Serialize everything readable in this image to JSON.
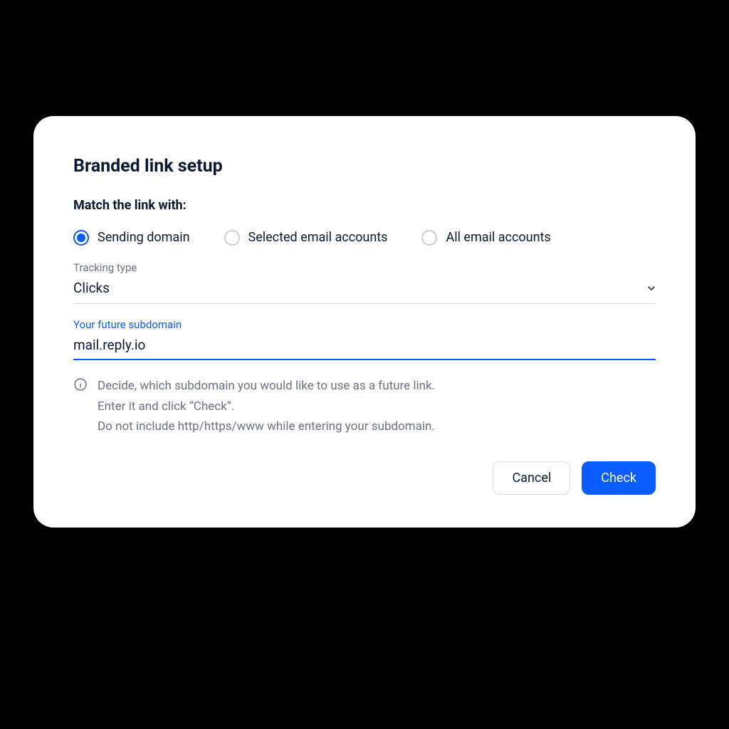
{
  "title": "Branded link setup",
  "subtitle": "Match the link with:",
  "radios": {
    "opt0": "Sending domain",
    "opt1": "Selected email accounts",
    "opt2": "All email accounts"
  },
  "tracking": {
    "label": "Tracking type",
    "value": "Clicks"
  },
  "subdomain": {
    "label": "Your future subdomain",
    "value": "mail.reply.io"
  },
  "info": {
    "line1": "Decide, which subdomain you would like to use as a future link.",
    "line2": "Enter it and click “Check”.",
    "line3": "Do not include http/https/www while entering your subdomain."
  },
  "buttons": {
    "cancel": "Cancel",
    "check": "Check"
  }
}
